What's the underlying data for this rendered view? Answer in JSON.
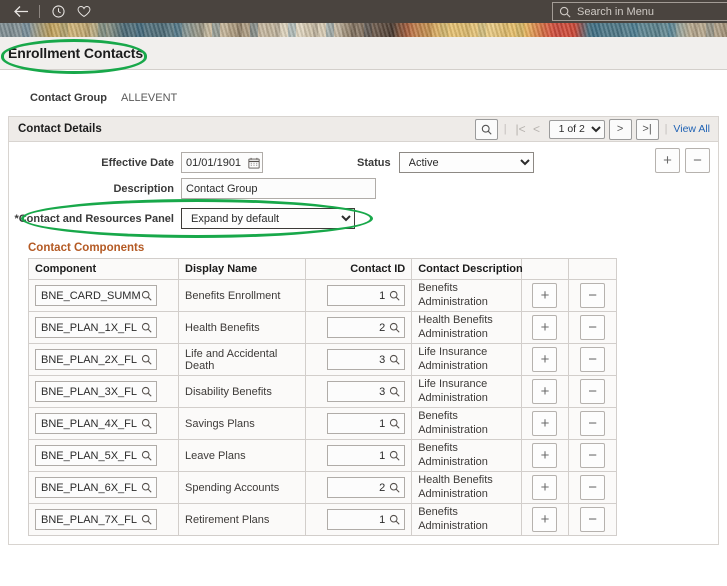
{
  "topbar": {
    "back_icon": "back-arrow-icon",
    "recent_icon": "clock-icon",
    "favorites_icon": "heart-icon",
    "search_placeholder": "Search in Menu",
    "search_icon": "search-icon",
    "background_color": "#4a443f"
  },
  "page": {
    "title": "Enrollment Contacts",
    "highlight_color": "#18a84a"
  },
  "contact_group": {
    "label": "Contact Group",
    "value": "ALLEVENT"
  },
  "contact_details": {
    "title": "Contact Details",
    "search_icon": "search-icon",
    "first_icon": "first-page-icon",
    "prev_icon": "previous-page-icon",
    "page_indicator": "1 of 2",
    "next_icon": "next-page-icon",
    "last_icon": "last-page-icon",
    "view_all": "View All",
    "add_row_label": "+",
    "delete_row_label": "−",
    "effective_date_label": "Effective Date",
    "effective_date_value": "01/01/1901",
    "calendar_icon": "calendar-icon",
    "status_label": "Status",
    "status_value": "Active",
    "description_label": "Description",
    "description_value": "Contact Group",
    "panel_label": "*Contact and Resources Panel",
    "panel_value": "Expand by default"
  },
  "contact_components": {
    "title": "Contact Components",
    "columns": [
      "Component",
      "Display Name",
      "Contact ID",
      "Contact Description",
      "",
      ""
    ],
    "add_label": "+",
    "delete_label": "−",
    "lookup_icon": "magnifier-lookup-icon",
    "rows": [
      {
        "component": "BNE_CARD_SUMM",
        "display_name": "Benefits Enrollment",
        "contact_id": "1",
        "description": "Benefits Administration"
      },
      {
        "component": "BNE_PLAN_1X_FL",
        "display_name": "Health Benefits",
        "contact_id": "2",
        "description": "Health Benefits Administration"
      },
      {
        "component": "BNE_PLAN_2X_FL",
        "display_name": "Life and Accidental Death",
        "contact_id": "3",
        "description": "Life Insurance Administration"
      },
      {
        "component": "BNE_PLAN_3X_FL",
        "display_name": "Disability Benefits",
        "contact_id": "3",
        "description": "Life Insurance Administration"
      },
      {
        "component": "BNE_PLAN_4X_FL",
        "display_name": "Savings Plans",
        "contact_id": "1",
        "description": "Benefits Administration"
      },
      {
        "component": "BNE_PLAN_5X_FL",
        "display_name": "Leave Plans",
        "contact_id": "1",
        "description": "Benefits Administration"
      },
      {
        "component": "BNE_PLAN_6X_FL",
        "display_name": "Spending Accounts",
        "contact_id": "2",
        "description": "Health Benefits Administration"
      },
      {
        "component": "BNE_PLAN_7X_FL",
        "display_name": "Retirement Plans",
        "contact_id": "1",
        "description": "Benefits Administration"
      }
    ]
  }
}
